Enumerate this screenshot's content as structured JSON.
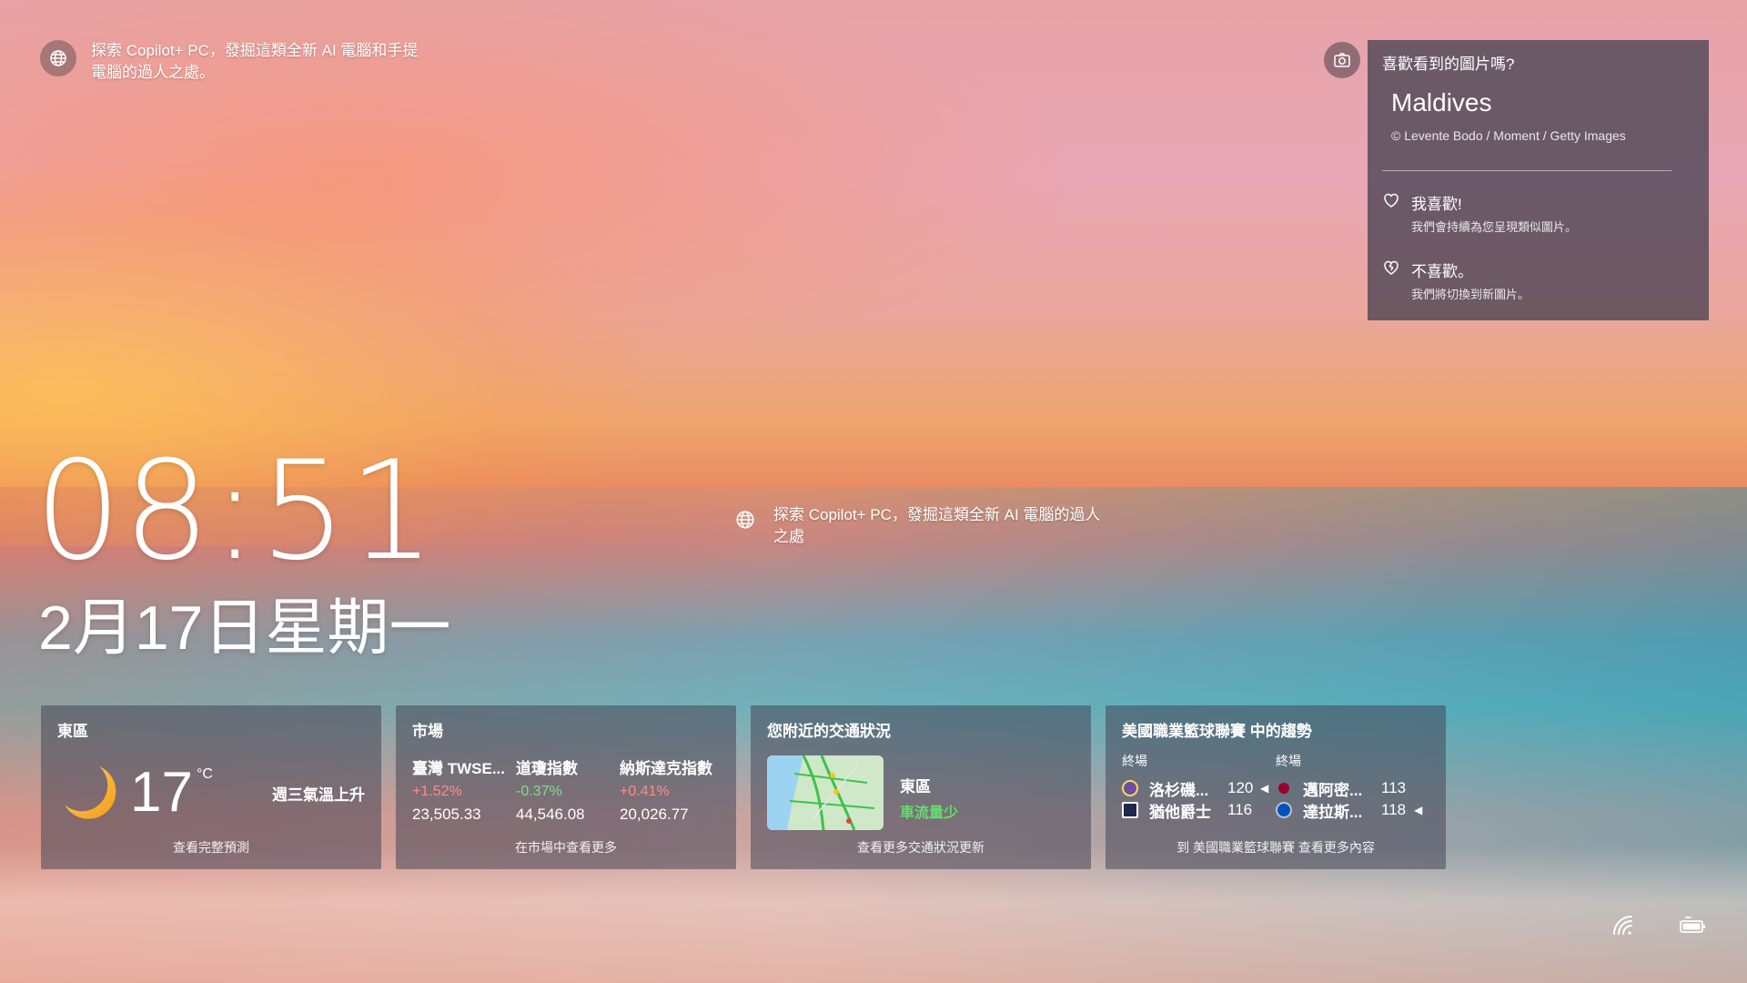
{
  "top_promo": {
    "text": "探索 Copilot+ PC，發掘這類全新 AI 電腦和手提電腦的過人之處。"
  },
  "center_promo": {
    "text": "探索 Copilot+ PC，發掘這類全新 AI 電腦的過人之處"
  },
  "photo_panel": {
    "question": "喜歡看到的圖片嗎?",
    "location": "Maldives",
    "credit": "© Levente Bodo / Moment / Getty Images",
    "like": {
      "title": "我喜歡!",
      "subtitle": "我們會持續為您呈現類似圖片。"
    },
    "dislike": {
      "title": "不喜歡。",
      "subtitle": "我們將切換到新圖片。"
    }
  },
  "clock": {
    "time": "08:51",
    "date": "2月17日星期一"
  },
  "weather": {
    "location": "東區",
    "temperature": "17",
    "unit": "°C",
    "condition": "週三氣溫上升",
    "footer": "查看完整預測"
  },
  "market": {
    "title": "市場",
    "indices": [
      {
        "name": "臺灣 TWSE...",
        "change": "+1.52%",
        "value": "23,505.33",
        "direction": "up"
      },
      {
        "name": "道瓊指數",
        "change": "-0.37%",
        "value": "44,546.08",
        "direction": "down"
      },
      {
        "name": "納斯達克指數",
        "change": "+0.41%",
        "value": "20,026.77",
        "direction": "up"
      }
    ],
    "footer": "在市場中查看更多"
  },
  "traffic": {
    "title": "您附近的交通狀況",
    "location": "東區",
    "status": "車流量少",
    "footer": "查看更多交通狀況更新"
  },
  "nba": {
    "title": "美國職業籃球聯賽 中的趨勢",
    "games": [
      {
        "status": "終場",
        "teams": [
          {
            "name": "洛杉磯...",
            "score": "120",
            "winner": true,
            "color": "#6b4fa0"
          },
          {
            "name": "猶他爵士",
            "score": "116",
            "winner": false,
            "color": "#1d2a4d"
          }
        ]
      },
      {
        "status": "終場",
        "teams": [
          {
            "name": "邁阿密...",
            "score": "113",
            "winner": false,
            "color": "#98002e"
          },
          {
            "name": "達拉斯...",
            "score": "118",
            "winner": true,
            "color": "#0053bc"
          }
        ]
      }
    ],
    "footer": "到 美國職業籃球聯賽 查看更多內容"
  },
  "colors": {
    "up": "#ff8a8a",
    "down": "#7ee08a",
    "traffic_light": "#5ee06c"
  }
}
